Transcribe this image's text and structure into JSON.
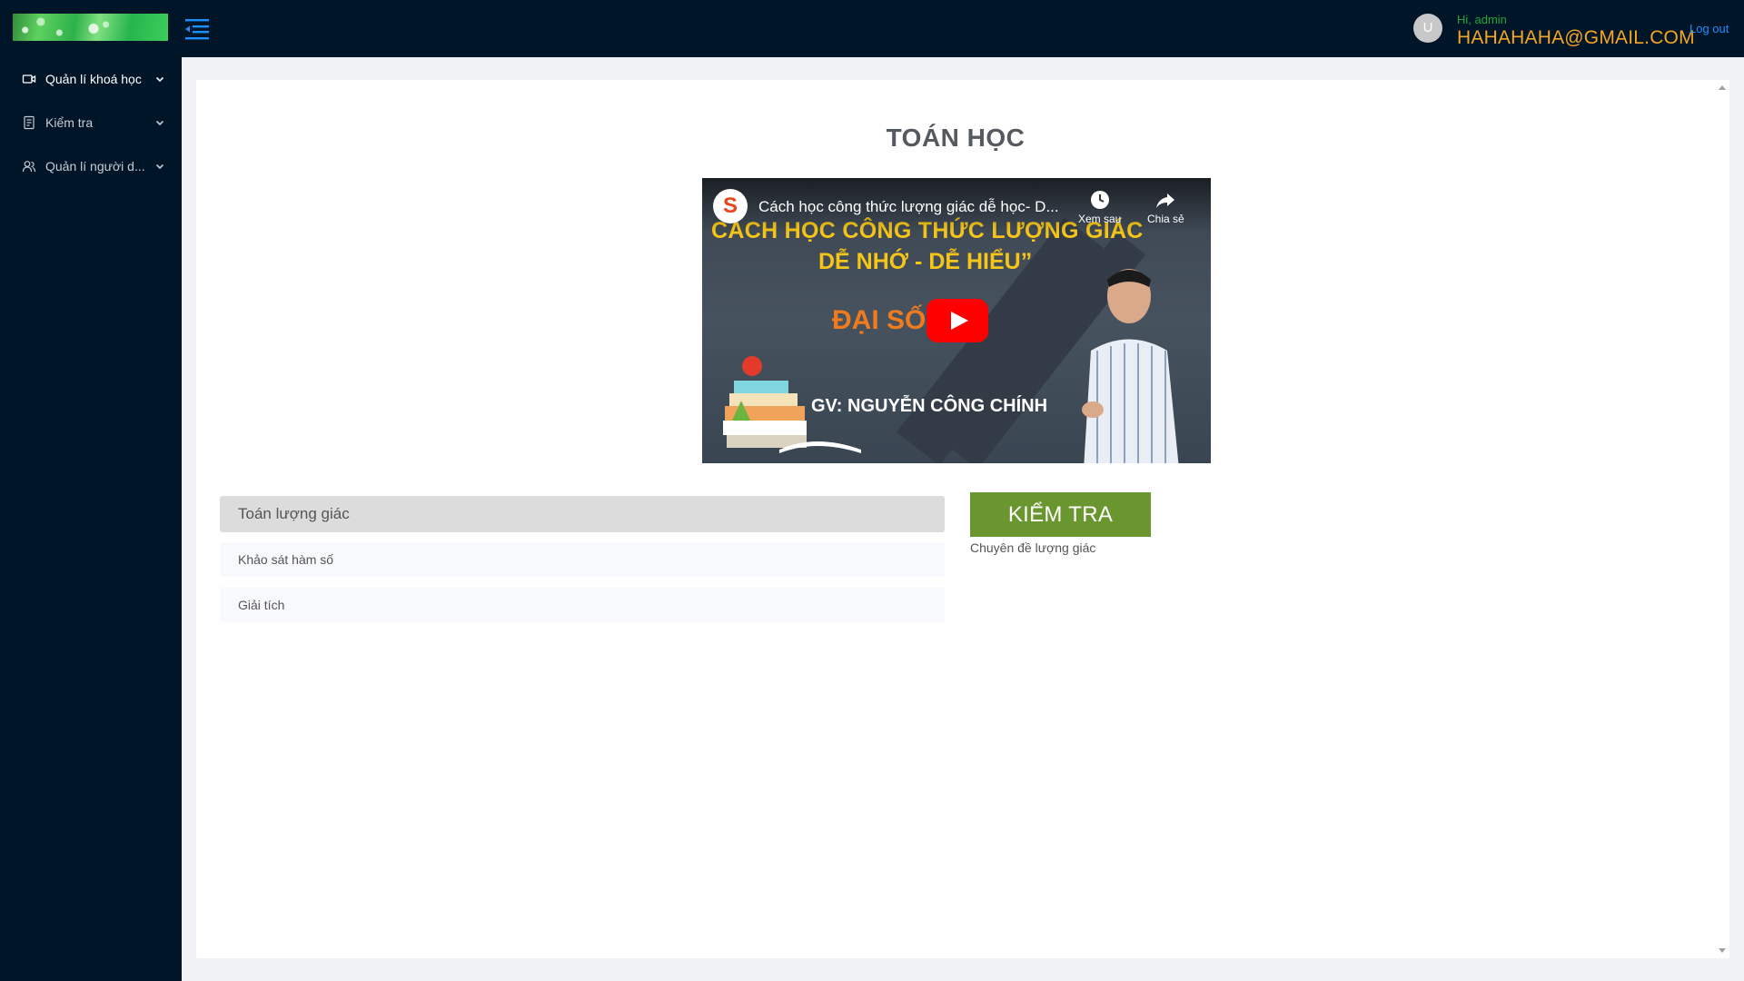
{
  "header": {
    "menu_toggle_icon": "menu-fold-icon",
    "user": {
      "avatar_initial": "U",
      "greeting": "Hi, admin",
      "email": "HAHAHAHA@GMAIL.COM",
      "logout_label": "Log out"
    }
  },
  "sidebar": {
    "items": [
      {
        "label": "Quản lí khoá học",
        "icon": "video-camera-icon",
        "active": true
      },
      {
        "label": "Kiểm tra",
        "icon": "test-form-icon",
        "active": false
      },
      {
        "label": "Quản lí người d...",
        "icon": "users-icon",
        "active": false
      }
    ]
  },
  "main": {
    "title": "TOÁN HỌC",
    "video": {
      "channel_initial": "S",
      "title": "Cách học công thức lượng giác dễ học- D...",
      "watch_later_label": "Xem sau",
      "share_label": "Chia sẻ",
      "thumbnail_line1": "CÁCH HỌC CÔNG THỨC LƯỢNG GIÁC",
      "thumbnail_line2": "DỄ NHỚ - DỄ HIỂU”",
      "thumbnail_subject": "ĐẠI SỐ",
      "thumbnail_teacher": "GV: NGUYỄN CÔNG CHÍNH"
    },
    "lessons": [
      {
        "label": "Toán lượng giác",
        "active": true
      },
      {
        "label": "Khảo sát hàm số",
        "active": false
      },
      {
        "label": "Giải tích",
        "active": false
      }
    ],
    "test_button_label": "KIỂM TRA",
    "test_caption": "Chuyên đề lượng giác"
  },
  "colors": {
    "header_bg": "#011529",
    "accent": "#1890ff",
    "email": "#f5a623",
    "greeting": "#22a63a",
    "test_button": "#6a9630"
  }
}
